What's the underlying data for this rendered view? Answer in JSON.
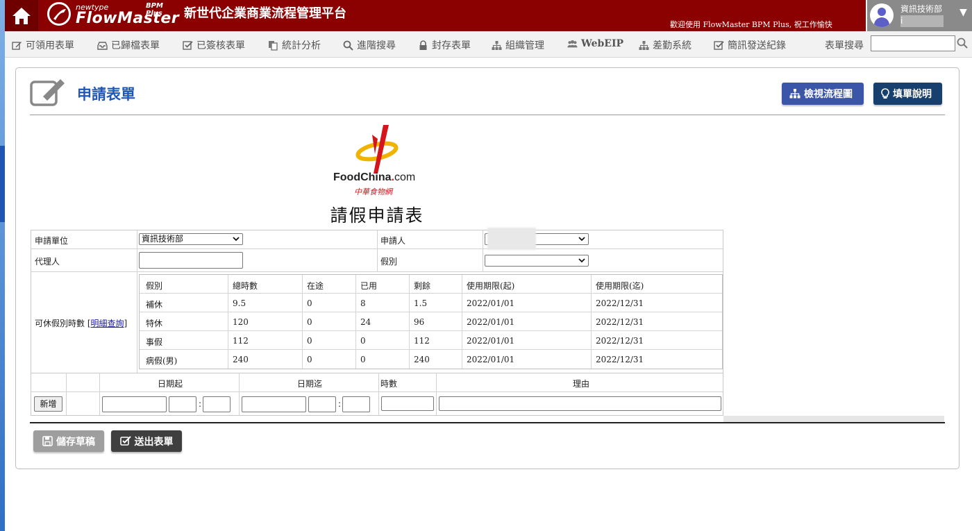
{
  "header": {
    "logo_newtype": "newtype",
    "logo_bpm_plus": "BPM Plus",
    "logo_flowmaster": "FlowMaster",
    "app_title": "新世代企業商業流程管理平台",
    "welcome": "歡迎使用 FlowMaster BPM Plus, 祝工作愉快",
    "user_dept": "資訊技術部",
    "user_id": "i"
  },
  "menu": {
    "items": [
      {
        "label": "可領用表單",
        "icon": "edit-icon"
      },
      {
        "label": "已歸檔表單",
        "icon": "inbox-icon"
      },
      {
        "label": "已簽核表單",
        "icon": "check-square-icon"
      },
      {
        "label": "統計分析",
        "icon": "copy-icon"
      },
      {
        "label": "進階搜尋",
        "icon": "search-icon"
      },
      {
        "label": "封存表單",
        "icon": "lock-icon"
      },
      {
        "label": "組織管理",
        "icon": "sitemap-icon"
      },
      {
        "label": "WebEIP",
        "icon": "users-icon"
      },
      {
        "label": "差勤系統",
        "icon": "sitemap-icon"
      },
      {
        "label": "簡訊發送紀錄",
        "icon": "check-square-icon"
      }
    ],
    "search_label": "表單搜尋",
    "search_value": ""
  },
  "page": {
    "title": "申請表單",
    "view_flow_button": "檢視流程圖",
    "help_button": "填單說明"
  },
  "form": {
    "logo_brand": "FoodChina",
    "logo_dot": ".",
    "logo_com": "com",
    "logo_subtitle": "中華食物網",
    "title": "請假申請表",
    "unit_label": "申請單位",
    "unit_value": "資訊技術部",
    "applicant_label": "申請人",
    "applicant_value": "",
    "agent_label": "代理人",
    "agent_value": "",
    "leave_type_label": "假別",
    "leave_type_value": "",
    "available_label": "可休假別時數",
    "detail_link": "明細查詢",
    "leave_table": {
      "headers": [
        "假別",
        "總時數",
        "在途",
        "已用",
        "剩餘",
        "使用期限(起)",
        "使用期限(迄)"
      ],
      "rows": [
        [
          "補休",
          "9.5",
          "0",
          "8",
          "1.5",
          "2022/01/01",
          "2022/12/31"
        ],
        [
          "特休",
          "120",
          "0",
          "24",
          "96",
          "2022/01/01",
          "2022/12/31"
        ],
        [
          "事假",
          "112",
          "0",
          "0",
          "112",
          "2022/01/01",
          "2022/12/31"
        ],
        [
          "病假(男)",
          "240",
          "0",
          "0",
          "240",
          "2022/01/01",
          "2022/12/31"
        ]
      ]
    },
    "date_headers": {
      "start": "日期起",
      "end": "日期迄",
      "hours": "時數",
      "reason": "理由"
    },
    "add_button": "新增",
    "time_sep": ":",
    "save_draft_button": "儲存草稿",
    "submit_button": "送出表單"
  },
  "colors": {
    "header_bg": "#8b0000",
    "title_blue": "#1f57b5",
    "btn_flow": "#3b55a8",
    "btn_help": "#17406e"
  }
}
